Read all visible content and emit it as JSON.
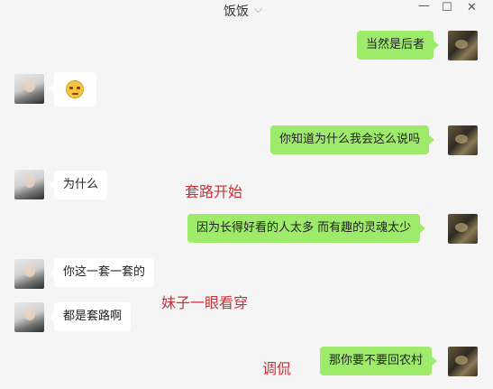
{
  "window": {
    "title": "饭饭",
    "chevron": "⌵",
    "min": "—",
    "max": "☐",
    "close": "✕"
  },
  "messages": [
    {
      "from": "me",
      "text": "当然是后者"
    },
    {
      "from": "her",
      "emoji": "smirk-face-emoji"
    },
    {
      "from": "me",
      "text": "你知道为什么我会这么说吗"
    },
    {
      "from": "her",
      "text": "为什么"
    },
    {
      "from": "me",
      "text": "因为长得好看的人太多  而有趣的灵魂太少"
    },
    {
      "from": "her",
      "text": "你这一套一套的"
    },
    {
      "from": "her",
      "text": "都是套路啊"
    },
    {
      "from": "me",
      "text": "那你要不要回农村"
    }
  ],
  "annotations": [
    "套路开始",
    "妹子一眼看穿",
    "调侃"
  ],
  "colors": {
    "background": "#f5f5f5",
    "outgoing_bubble": "#9eea6a",
    "incoming_bubble": "#ffffff",
    "annotation": "#c8323a"
  }
}
